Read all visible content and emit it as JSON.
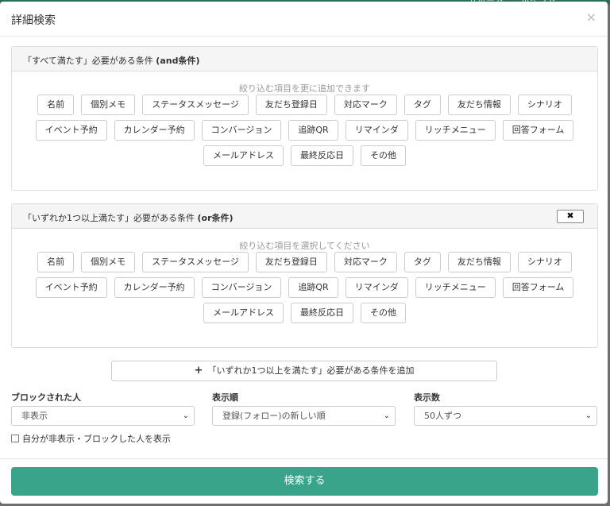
{
  "modal": {
    "title": "詳細検索",
    "close": "×"
  },
  "and_panel": {
    "title_prefix": "「すべて満たす」必要がある条件 ",
    "title_bold": "(and条件)",
    "hint": "絞り込む項目を更に追加できます",
    "rows": [
      [
        "名前",
        "個別メモ",
        "ステータスメッセージ",
        "友だち登録日",
        "対応マーク",
        "タグ",
        "友だち情報",
        "シナリオ"
      ],
      [
        "イベント予約",
        "カレンダー予約",
        "コンバージョン",
        "追跡QR",
        "リマインダ",
        "リッチメニュー",
        "回答フォーム"
      ],
      [
        "メールアドレス",
        "最終反応日",
        "その他"
      ]
    ]
  },
  "or_panel": {
    "title_prefix": "「いずれか1つ以上満たす」必要がある条件 ",
    "title_bold": "(or条件)",
    "remove_label": "✖",
    "hint": "絞り込む項目を選択してください",
    "rows": [
      [
        "名前",
        "個別メモ",
        "ステータスメッセージ",
        "友だち登録日",
        "対応マーク",
        "タグ",
        "友だち情報",
        "シナリオ"
      ],
      [
        "イベント予約",
        "カレンダー予約",
        "コンバージョン",
        "追跡QR",
        "リマインダ",
        "リッチメニュー",
        "回答フォーム"
      ],
      [
        "メールアドレス",
        "最終反応日",
        "その他"
      ]
    ]
  },
  "add_or_button": {
    "plus": "+",
    "label": "「いずれか1つ以上を満たす」必要がある条件を追加"
  },
  "filters": {
    "blocked": {
      "label": "ブロックされた人",
      "value": "非表示"
    },
    "order": {
      "label": "表示順",
      "value": "登録(フォロー)の新しい順"
    },
    "count": {
      "label": "表示数",
      "value": "50人ずつ"
    },
    "caret": "⌄"
  },
  "checkbox": {
    "label": "自分が非表示・ブロックした人を表示",
    "checked": false
  },
  "search_button": "検索する",
  "backdrop_fragment": "サポート　　ポイント"
}
